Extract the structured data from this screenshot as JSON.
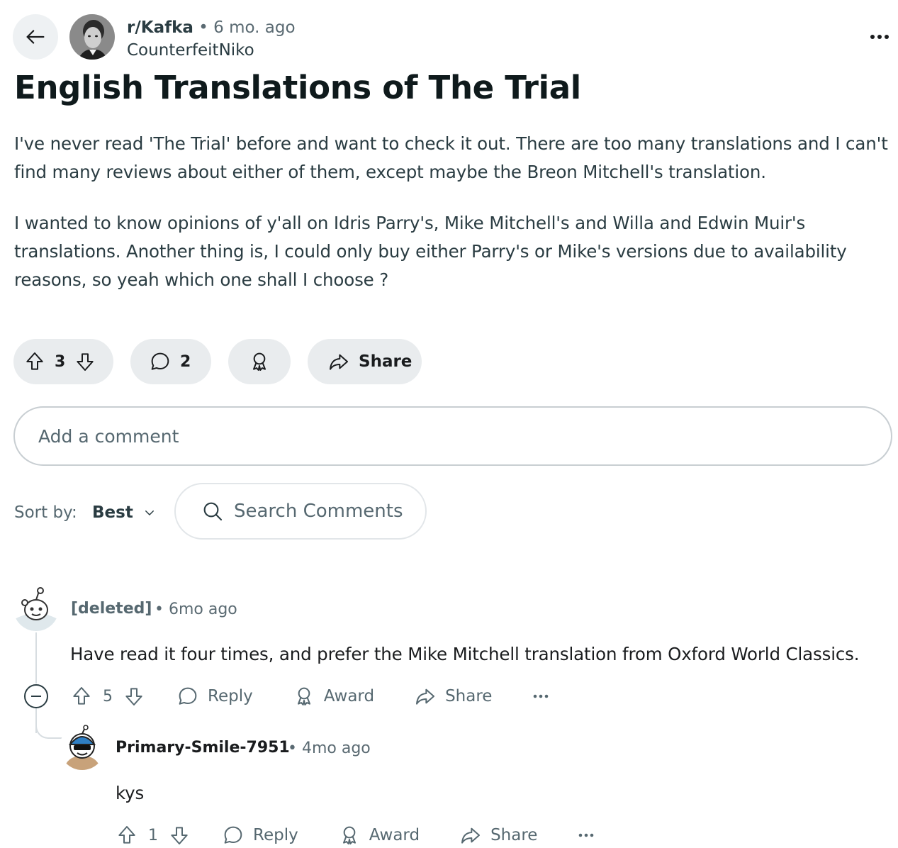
{
  "post": {
    "subreddit": "r/Kafka",
    "separator": "•",
    "age": "6 mo. ago",
    "author": "CounterfeitNiko",
    "title": "English Translations of The Trial",
    "body": [
      "I've never read 'The Trial' before and want to check it out. There are too many translations and I can't find many reviews about either of them, except maybe the Breon Mitchell's translation.",
      "I wanted to know opinions of y'all on Idris Parry's, Mike Mitchell's and Willa and Edwin Muir's translations. Another thing is, I could only buy either Parry's or Mike's versions due to availability reasons, so yeah which one shall I choose ?"
    ],
    "score": "3",
    "comment_count": "2",
    "share_label": "Share"
  },
  "comment_box": {
    "placeholder": "Add a comment"
  },
  "sort": {
    "label": "Sort by:",
    "value": "Best"
  },
  "search": {
    "placeholder": "Search Comments"
  },
  "comments": [
    {
      "user": "[deleted]",
      "meta": "• 6mo ago",
      "body": "Have read it four times, and prefer the Mike Mitchell translation from Oxford World Classics.",
      "score": "5",
      "reply_label": "Reply",
      "award_label": "Award",
      "share_label": "Share"
    },
    {
      "user": "Primary-Smile-7951",
      "meta": "• 4mo ago",
      "body": "kys",
      "score": "1",
      "reply_label": "Reply",
      "award_label": "Award",
      "share_label": "Share"
    }
  ],
  "icons": {
    "back": "arrow-left-icon",
    "more": "ellipsis-icon",
    "upvote": "arrow-up-outline-icon",
    "downvote": "arrow-down-outline-icon",
    "comment": "speech-bubble-icon",
    "award": "award-ribbon-icon",
    "share": "share-arrow-icon",
    "search": "magnifier-icon",
    "collapse": "minus-circle-icon",
    "chevron": "chevron-down-icon"
  },
  "colors": {
    "pill_bg": "#e9ecee",
    "text": "#2a3c42",
    "muted": "#566870"
  }
}
